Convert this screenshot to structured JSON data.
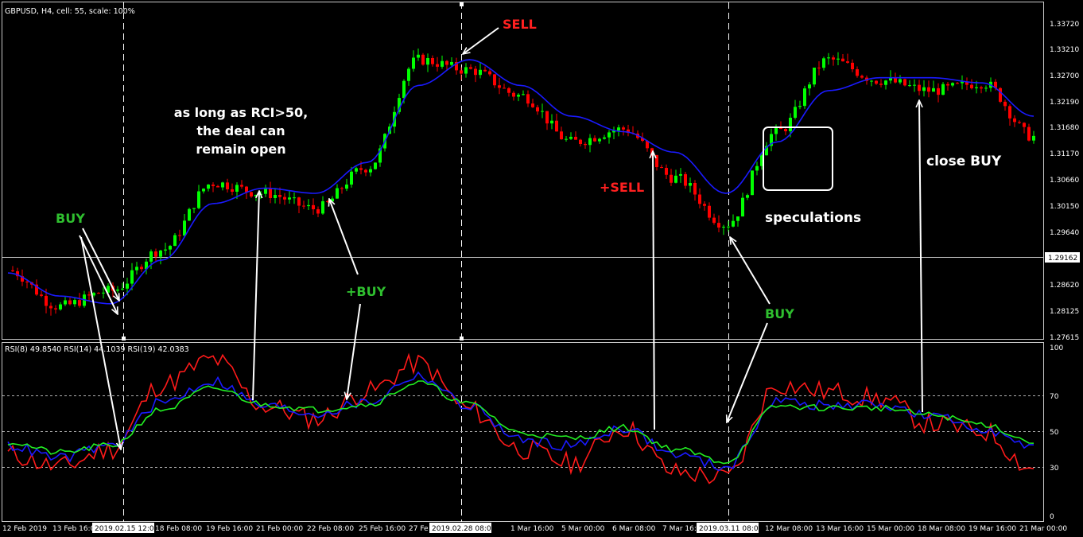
{
  "header": {
    "main_title": "GBPUSD, H4, cell: 55, scale: 100%",
    "indicator_title": "RSI(8) 49.8540  RSI(14) 44.1039  RSI(19) 42.0383"
  },
  "colors": {
    "background": "#000000",
    "bull_candle": "#00ff00",
    "bear_candle": "#ff0000",
    "moving_average": "#1a1aff",
    "rsi8": "#ff1a1a",
    "rsi14": "#1a1aff",
    "rsi19": "#22ee22",
    "annotation_white": "#ffffff",
    "annotation_red": "#ff2020",
    "annotation_green": "#2fbf2f"
  },
  "price_axis": {
    "ticks": [
      "1.33720",
      "1.33210",
      "1.32700",
      "1.32190",
      "1.31680",
      "1.31170",
      "1.30660",
      "1.30150",
      "1.29640",
      "1.28620",
      "1.28125",
      "1.27615"
    ],
    "current_price": "1.29162"
  },
  "rsi_axis": {
    "ticks": [
      "100",
      "70",
      "50",
      "30",
      "0"
    ]
  },
  "time_axis": {
    "labels": [
      "12 Feb 2019",
      "13 Feb 16:0",
      "2019.02.15 12:00",
      "18 Feb 08:00",
      "19 Feb 16:00",
      "21 Feb 00:00",
      "22 Feb 08:00",
      "25 Feb 16:00",
      "27 Fe",
      "2019.02.28 08:00",
      "1 Mar 16:00",
      "5 Mar 00:00",
      "6 Mar 08:00",
      "7 Mar 16:",
      "2019.03.11 08:00",
      "12 Mar 08:00",
      "13 Mar 16:00",
      "15 Mar 00:00",
      "18 Mar 08:00",
      "19 Mar 16:00",
      "21 Mar 00:00"
    ]
  },
  "annotations": {
    "buy1": "BUY",
    "buy2": "+BUY",
    "buy3": "BUY",
    "sell1": "SELL",
    "sell2": "+SELL",
    "rci_line1": "as long as RCI>50,",
    "rci_line2": "the deal can",
    "rci_line3": "remain open",
    "speculations": "speculations",
    "close_buy": "close BUY"
  },
  "chart_data": [
    {
      "type": "candlestick",
      "title": "GBPUSD, H4, cell: 55, scale: 100%",
      "ylim": [
        1.2755,
        1.339
      ],
      "x": [
        "12 Feb 2019",
        "13 Feb",
        "15 Feb",
        "18 Feb",
        "19 Feb",
        "21 Feb",
        "22 Feb",
        "25 Feb",
        "27 Feb",
        "28 Feb",
        "1 Mar",
        "5 Mar",
        "6 Mar",
        "7 Mar",
        "11 Mar",
        "12 Mar",
        "13 Mar",
        "15 Mar",
        "18 Mar",
        "19 Mar",
        "21 Mar"
      ],
      "close": [
        1.289,
        1.282,
        1.285,
        1.293,
        1.306,
        1.304,
        1.301,
        1.309,
        1.33,
        1.328,
        1.323,
        1.314,
        1.3165,
        1.307,
        1.298,
        1.316,
        1.33,
        1.326,
        1.324,
        1.3255,
        1.315
      ],
      "moving_average": [
        1.2885,
        1.284,
        1.2825,
        1.291,
        1.302,
        1.305,
        1.304,
        1.31,
        1.325,
        1.33,
        1.325,
        1.319,
        1.316,
        1.312,
        1.304,
        1.314,
        1.324,
        1.3265,
        1.3265,
        1.3255,
        1.319
      ]
    },
    {
      "type": "line",
      "title": "RSI(8) 49.8540  RSI(14) 44.1039  RSI(19) 42.0383",
      "ylim": [
        0,
        100
      ],
      "levels": [
        30,
        50,
        70
      ],
      "x": [
        "12 Feb 2019",
        "13 Feb",
        "15 Feb",
        "18 Feb",
        "19 Feb",
        "21 Feb",
        "22 Feb",
        "25 Feb",
        "27 Feb",
        "28 Feb",
        "1 Mar",
        "5 Mar",
        "6 Mar",
        "7 Mar",
        "11 Mar",
        "12 Mar",
        "13 Mar",
        "15 Mar",
        "18 Mar",
        "19 Mar",
        "21 Mar"
      ],
      "series": [
        {
          "name": "RSI(8)",
          "values": [
            35,
            28,
            38,
            74,
            88,
            62,
            55,
            70,
            86,
            60,
            38,
            30,
            50,
            25,
            22,
            74,
            70,
            66,
            52,
            48,
            27
          ]
        },
        {
          "name": "RSI(14)",
          "values": [
            40,
            33,
            40,
            64,
            76,
            62,
            58,
            64,
            79,
            62,
            43,
            40,
            50,
            35,
            28,
            65,
            62,
            63,
            56,
            50,
            38
          ]
        },
        {
          "name": "RSI(19)",
          "values": [
            42,
            36,
            40,
            60,
            72,
            63,
            60,
            63,
            75,
            63,
            47,
            44,
            50,
            38,
            31,
            62,
            61,
            61,
            57,
            52,
            42
          ]
        }
      ]
    }
  ]
}
